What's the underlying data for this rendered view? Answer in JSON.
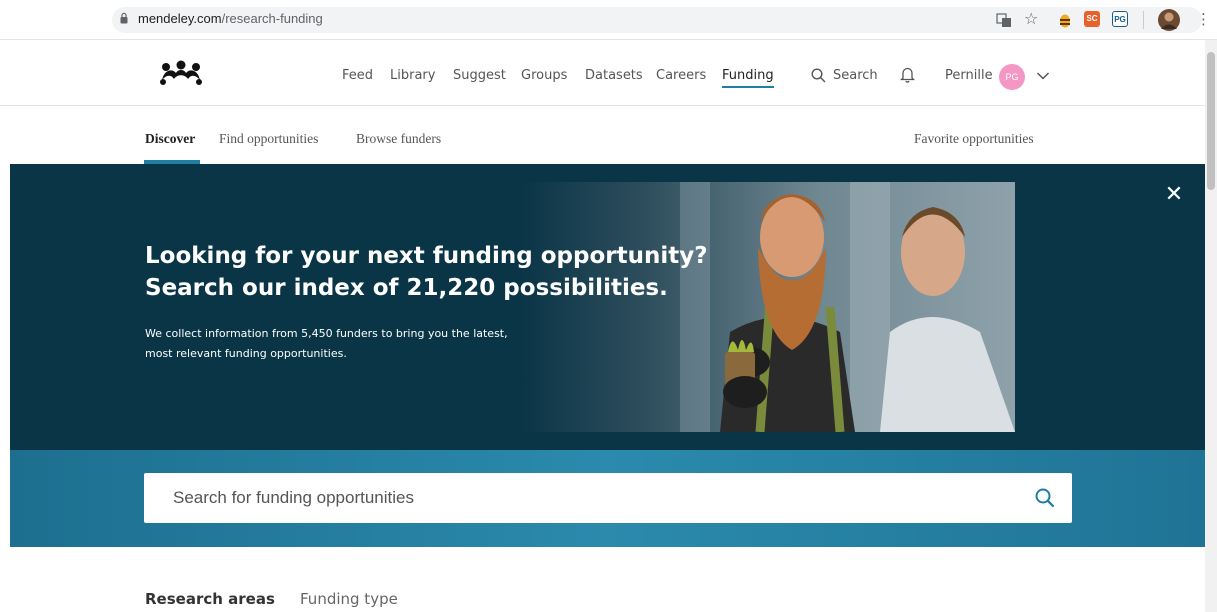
{
  "browser": {
    "url_domain": "mendeley.com",
    "url_path": "/research-funding",
    "extensions": [
      "translate-icon",
      "star-icon",
      "bee-extension-icon",
      "sc-extension-icon",
      "pg-extension-icon",
      "profile-avatar-icon",
      "more-vert-icon"
    ],
    "ext_sc_label": "SC",
    "ext_pg_label": "PG"
  },
  "topnav": {
    "links": [
      "Feed",
      "Library",
      "Suggest",
      "Groups",
      "Datasets",
      "Careers",
      "Funding"
    ],
    "active": "Funding",
    "search_label": "Search",
    "user_name": "Pernille",
    "user_initials": "PG"
  },
  "subnav": {
    "tabs": [
      "Discover",
      "Find opportunities",
      "Browse funders"
    ],
    "active": "Discover",
    "favorites_label": "Favorite opportunities"
  },
  "hero": {
    "title_line1": "Looking for your next funding opportunity?",
    "title_line2": "Search our index of 21,220 possibilities.",
    "sub_line1": "We collect information from 5,450 funders to bring you the latest,",
    "sub_line2": "most relevant funding opportunities.",
    "close_symbol": "✕"
  },
  "search": {
    "placeholder": "Search for funding opportunities",
    "value": ""
  },
  "bottom_tabs": {
    "tabs": [
      "Research areas",
      "Funding type"
    ],
    "active": "Research areas"
  },
  "colors": {
    "accent": "#1f7ea1",
    "hero_bg": "#0a3547",
    "avatar_pink": "#f497c4"
  }
}
